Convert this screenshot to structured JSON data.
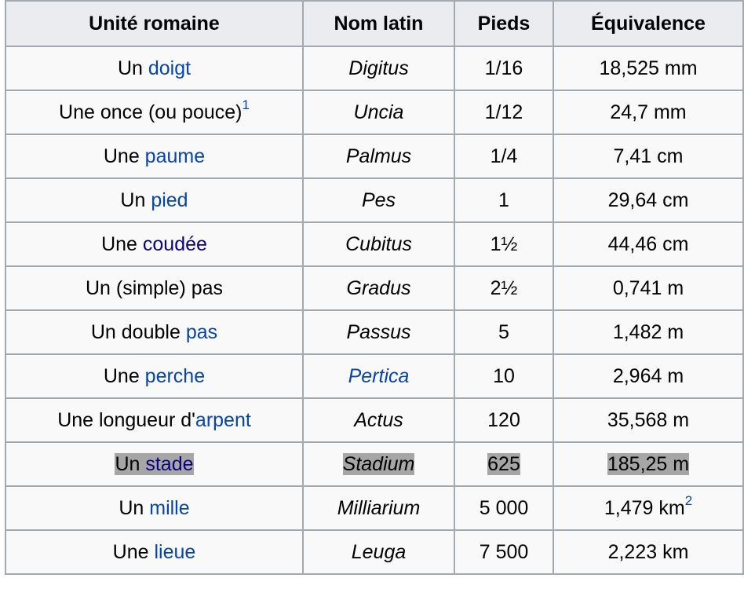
{
  "headers": [
    "Unité romaine",
    "Nom latin",
    "Pieds",
    "Équivalence"
  ],
  "rows": [
    {
      "prefix": "Un ",
      "link": "doigt",
      "suffix": "",
      "latin": "Digitus",
      "pieds": "1/16",
      "equiv": "18,525 mm",
      "ref": ""
    },
    {
      "prefix": "Une once (ou pouce)",
      "link": "",
      "suffix": "",
      "ref_unit": "1",
      "latin": "Uncia",
      "pieds": "1/12",
      "equiv": "24,7 mm",
      "ref": ""
    },
    {
      "prefix": "Une ",
      "link": "paume",
      "suffix": "",
      "latin": "Palmus",
      "pieds": "1/4",
      "equiv": "7,41 cm",
      "ref": ""
    },
    {
      "prefix": "Un ",
      "link": "pied",
      "suffix": "",
      "latin": "Pes",
      "pieds": "1",
      "equiv": "29,64 cm",
      "ref": ""
    },
    {
      "prefix": "Une ",
      "link": "coudée",
      "suffix": "",
      "latin": "Cubitus",
      "pieds": "1½",
      "equiv": "44,46 cm",
      "ref": ""
    },
    {
      "prefix": "Un (simple) pas",
      "link": "",
      "suffix": "",
      "latin": "Gradus",
      "pieds": "2½",
      "equiv": "0,741 m",
      "ref": ""
    },
    {
      "prefix": "Un double ",
      "link": "pas",
      "suffix": "",
      "latin": "Passus",
      "pieds": "5",
      "equiv": "1,482 m",
      "ref": ""
    },
    {
      "prefix": "Une ",
      "link": "perche",
      "suffix": "",
      "latin": "Pertica",
      "latin_link": true,
      "pieds": "10",
      "equiv": "2,964 m",
      "ref": ""
    },
    {
      "prefix": "Une longueur d'",
      "link": "arpent",
      "suffix": "",
      "latin": "Actus",
      "pieds": "120",
      "equiv": "35,568 m",
      "ref": ""
    },
    {
      "prefix": "Un ",
      "link": "stade",
      "suffix": "",
      "latin": "Stadium",
      "pieds": "625",
      "equiv": "185,25 m",
      "ref": "",
      "selected": true
    },
    {
      "prefix": "Un ",
      "link": "mille",
      "suffix": "",
      "latin": "Milliarium",
      "pieds": "5 000",
      "equiv": "1,479 km",
      "ref": "2"
    },
    {
      "prefix": "Une ",
      "link": "lieue",
      "suffix": "",
      "latin": "Leuga",
      "pieds": "7 500",
      "equiv": "2,223 km",
      "ref": ""
    }
  ],
  "colors": {
    "link_visited": "#0b0080",
    "link": "#0645ad",
    "border": "#a2a9b1",
    "header_bg": "#eaecf0",
    "cell_bg": "#f9f9f9",
    "selection": "#a6a6a6"
  }
}
